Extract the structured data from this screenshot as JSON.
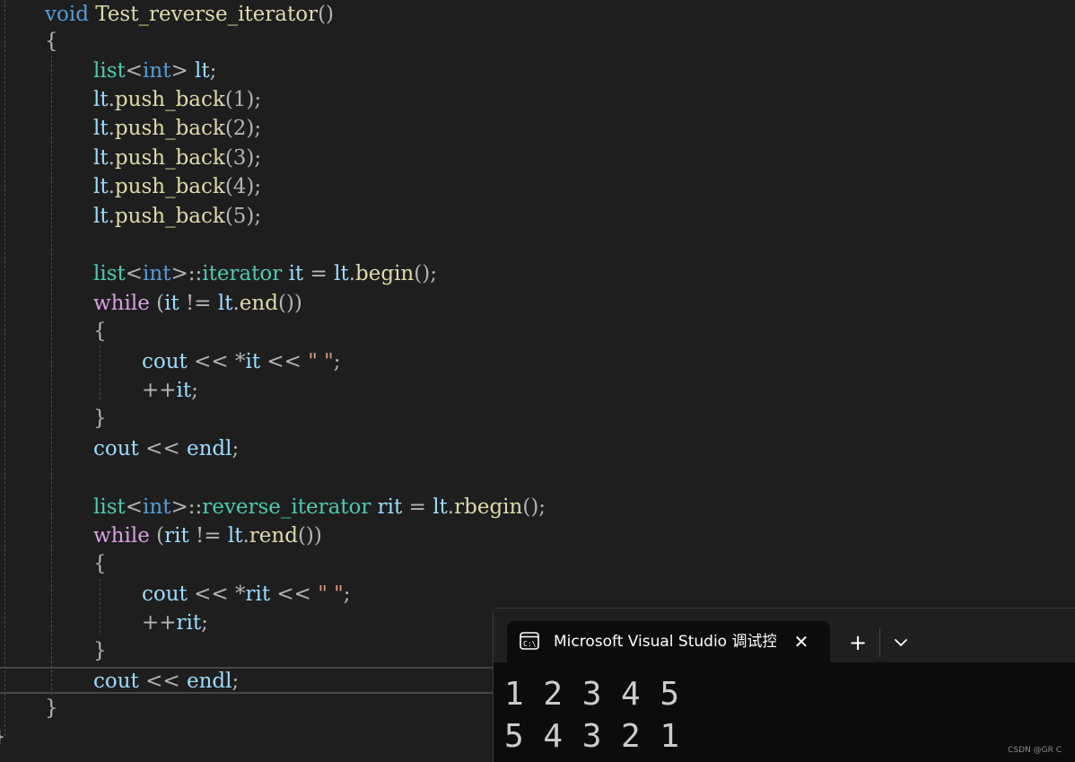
{
  "editor": {
    "function_signature": {
      "keyword": "void",
      "name": "Test_reverse_iterator",
      "parens": "()"
    },
    "open_brace": "{",
    "close_brace": "}",
    "decl_list": {
      "type": "list",
      "lt": "<",
      "tparam": "int",
      "gt": ">",
      "var": " lt",
      "end": ";"
    },
    "push_backs": [
      {
        "obj": "lt",
        "dot": ".",
        "method": "push_back",
        "arg": "(1)",
        "end": ";"
      },
      {
        "obj": "lt",
        "dot": ".",
        "method": "push_back",
        "arg": "(2)",
        "end": ";"
      },
      {
        "obj": "lt",
        "dot": ".",
        "method": "push_back",
        "arg": "(3)",
        "end": ";"
      },
      {
        "obj": "lt",
        "dot": ".",
        "method": "push_back",
        "arg": "(4)",
        "end": ";"
      },
      {
        "obj": "lt",
        "dot": ".",
        "method": "push_back",
        "arg": "(5)",
        "end": ";"
      }
    ],
    "forward": {
      "decl_type": "list",
      "decl_lt": "<",
      "decl_tparam": "int",
      "decl_gt": ">",
      "decl_scope": "::",
      "decl_iter": "iterator",
      "decl_var": " it",
      "decl_eq": " = ",
      "decl_obj": "lt",
      "decl_dot": ".",
      "decl_method": "begin",
      "decl_end": "();",
      "while_kw": "while",
      "while_open": " (",
      "while_var": "it",
      "while_op": " != ",
      "while_obj": "lt",
      "while_dot": ".",
      "while_method": "end",
      "while_close": "())",
      "brace_open": "{",
      "brace_close": "}",
      "cout": "cout",
      "shl1": " << ",
      "deref": "*",
      "deref_var": "it",
      "shl2": " << ",
      "str": "\" \"",
      "semi": ";",
      "inc": "++",
      "inc_var": "it",
      "inc_semi": ";",
      "endl_cout": "cout",
      "endl_shl": " << ",
      "endl_word": "endl",
      "endl_semi": ";"
    },
    "reverse": {
      "decl_type": "list",
      "decl_lt": "<",
      "decl_tparam": "int",
      "decl_gt": ">",
      "decl_scope": "::",
      "decl_iter": "reverse_iterator",
      "decl_var": " rit",
      "decl_eq": " = ",
      "decl_obj": "lt",
      "decl_dot": ".",
      "decl_method": "rbegin",
      "decl_end": "();",
      "while_kw": "while",
      "while_open": " (",
      "while_var": "rit",
      "while_op": " != ",
      "while_obj": "lt",
      "while_dot": ".",
      "while_method": "rend",
      "while_close": "())",
      "brace_open": "{",
      "brace_close": "}",
      "cout": "cout",
      "shl1": " << ",
      "deref": "*",
      "deref_var": "rit",
      "shl2": " << ",
      "str": "\" \"",
      "semi": ";",
      "inc": "++",
      "inc_var": "rit",
      "inc_semi": ";",
      "endl_cout": "cout",
      "endl_shl": " << ",
      "endl_word": "endl",
      "endl_semi": ";"
    },
    "colors": {
      "keyword": "#569cd6",
      "control": "#d8a0df",
      "type": "#4ec9b0",
      "function": "#dcdcaa",
      "variable": "#9cdcfe",
      "string": "#d69d85",
      "background": "#1e1e1e"
    }
  },
  "terminal": {
    "tab_icon": "terminal-icon",
    "tab_title": "Microsoft Visual Studio 调试控",
    "close_glyph": "✕",
    "new_tab_glyph": "+",
    "dropdown_icon": "chevron-down-icon",
    "output_lines": [
      "1 2 3 4 5",
      "5 4 3 2 1"
    ]
  },
  "watermark": "CSDN @GR C"
}
